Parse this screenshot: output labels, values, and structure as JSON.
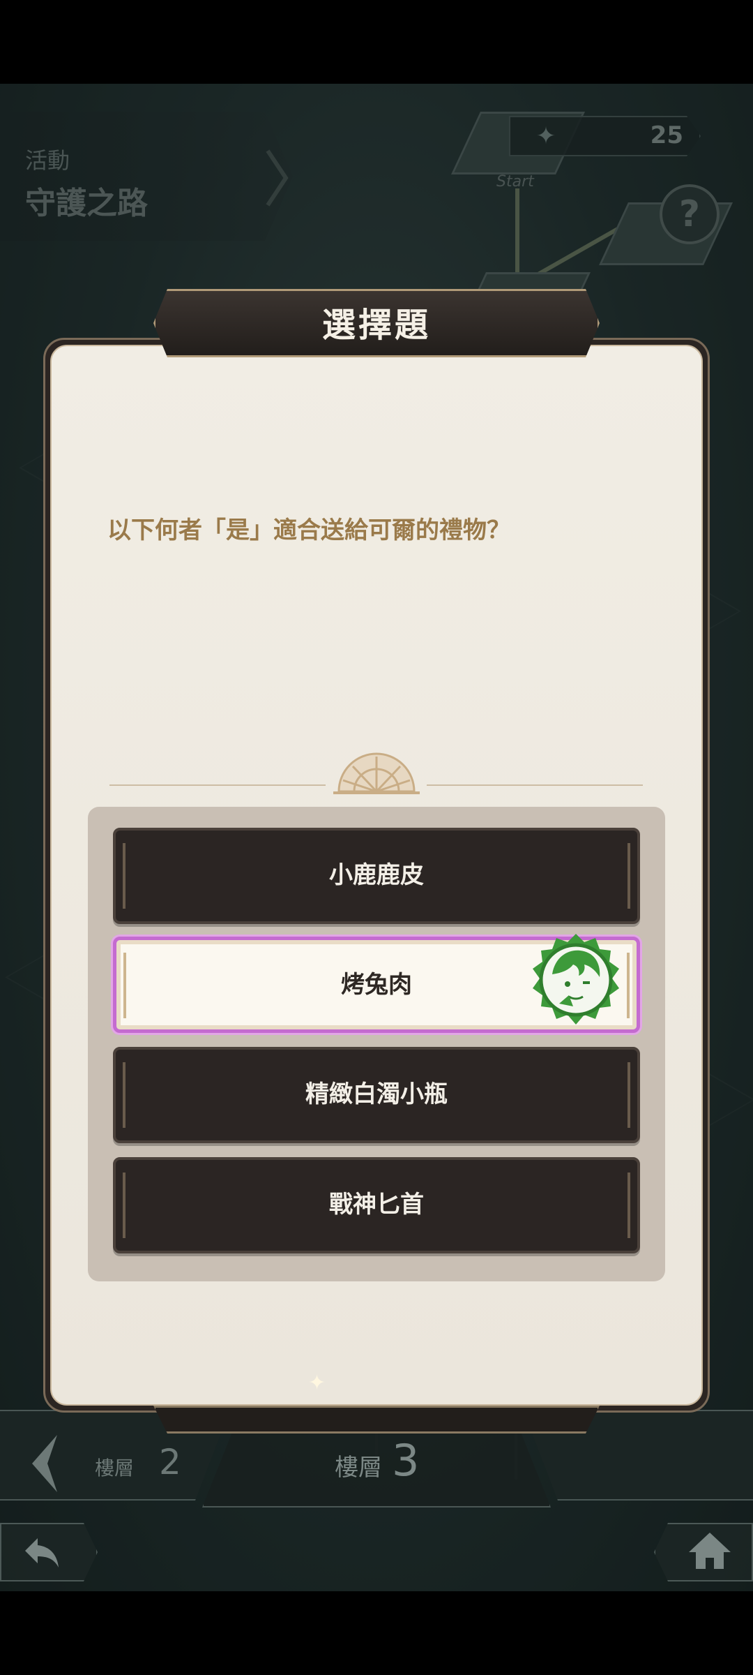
{
  "activity": {
    "subtitle": "活動",
    "title": "守護之路"
  },
  "counter": {
    "value": "25",
    "icon": "gem-icon"
  },
  "map": {
    "start_label": "Start"
  },
  "help": {
    "label": "?"
  },
  "dialog": {
    "title": "選擇題",
    "question": "以下何者「是」適合送給可爾的禮物？",
    "answers": [
      {
        "label": "小鹿鹿皮",
        "selected": false
      },
      {
        "label": "烤兔肉",
        "selected": true
      },
      {
        "label": "精緻白濁小瓶",
        "selected": false
      },
      {
        "label": "戰神匕首",
        "selected": false
      }
    ],
    "selected_badge_icon": "character-avatar-icon"
  },
  "floor": {
    "prev_label": "樓層",
    "prev_number": "2",
    "current_label": "樓層",
    "current_number": "3"
  },
  "colors": {
    "accent_selected": "#c46bd0",
    "question_text": "#9a7a4a",
    "answer_bg": "#2b2523",
    "badge_green": "#3d9a3a"
  }
}
